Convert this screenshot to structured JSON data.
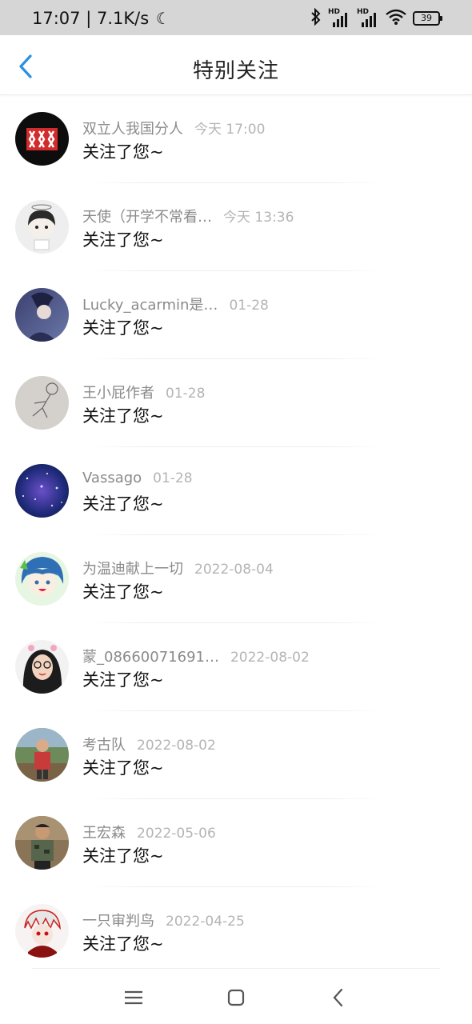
{
  "status_bar": {
    "time": "17:07",
    "speed": "7.1K/s",
    "battery": "39",
    "signal_label": "HD",
    "icons": [
      "moon-icon",
      "bluetooth-icon",
      "signal-icon",
      "signal-icon",
      "wifi-icon",
      "battery-icon"
    ]
  },
  "header": {
    "title": "特别关注",
    "back_icon": "chevron-left-icon",
    "accent_color": "#2b8fe0"
  },
  "items": [
    {
      "name": "双立人我国分人",
      "time": "今天 17:00",
      "message": "关注了您~"
    },
    {
      "name": "天使（开学不常看…",
      "time": "今天 13:36",
      "message": "关注了您~"
    },
    {
      "name": "Lucky_acarmin是…",
      "time": "01-28",
      "message": "关注了您~"
    },
    {
      "name": "王小屁作者",
      "time": "01-28",
      "message": "关注了您~"
    },
    {
      "name": "Vassago",
      "time": "01-28",
      "message": "关注了您~"
    },
    {
      "name": "为温迪献上一切",
      "time": "2022-08-04",
      "message": "关注了您~"
    },
    {
      "name": "蒙_08660071691…",
      "time": "2022-08-02",
      "message": "关注了您~"
    },
    {
      "name": "考古队",
      "time": "2022-08-02",
      "message": "关注了您~"
    },
    {
      "name": "王宏森",
      "time": "2022-05-06",
      "message": "关注了您~"
    },
    {
      "name": "一只审判鸟",
      "time": "2022-04-25",
      "message": "关注了您~"
    }
  ],
  "nav_bar": {
    "icons": [
      "menu-icon",
      "home-icon",
      "back-icon"
    ]
  }
}
